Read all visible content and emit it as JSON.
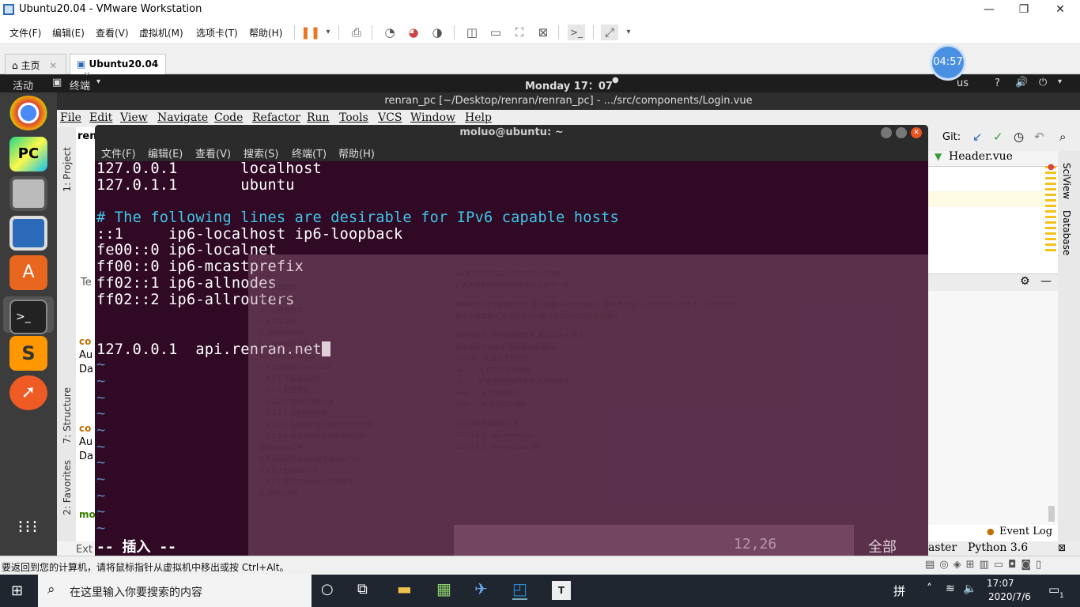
{
  "vmware": {
    "title": "Ubuntu20.04 - VMware Workstation",
    "menu": [
      "文件(F)",
      "编辑(E)",
      "查看(V)",
      "虚拟机(M)",
      "选项卡(T)",
      "帮助(H)"
    ],
    "tabs": [
      {
        "label": "主页"
      },
      {
        "label": "Ubuntu20.04"
      }
    ],
    "timer": "04:57",
    "status_text": "要返回到您的计算机，请将鼠标指针从虚拟机中移出或按 Ctrl+Alt。"
  },
  "ubuntu": {
    "activities": "活动",
    "app_menu": "终端",
    "clock": "Monday 17：07",
    "status_fragment": "us"
  },
  "ide": {
    "title": "renran_pc [~/Desktop/renran/renran_pc] - .../src/components/Login.vue",
    "menu": [
      "File",
      "Edit",
      "View",
      "Navigate",
      "Code",
      "Refactor",
      "Run",
      "Tools",
      "VCS",
      "Window",
      "Help"
    ],
    "git_label": "Git:",
    "file_tab": "Header.vue",
    "side_labels": [
      "1: Project",
      "7: Structure",
      "2: Favorites"
    ],
    "right_labels": [
      "SciView",
      "Database"
    ],
    "event_log": "Event Log",
    "branch": "aster",
    "interpreter": "Python 3.6",
    "fragments": [
      "ren",
      "Te",
      "co",
      "Au",
      "Da",
      "co",
      "Au",
      "Da",
      "mo",
      "Ext"
    ]
  },
  "terminal": {
    "title": "moluo@ubuntu: ~",
    "menu": [
      "文件(F)",
      "编辑(E)",
      "查看(V)",
      "搜索(S)",
      "终端(T)",
      "帮助(H)"
    ],
    "lines": [
      {
        "text": "127.0.0.1       localhost",
        "kind": "normal"
      },
      {
        "text": "127.0.1.1       ubuntu",
        "kind": "normal"
      },
      {
        "text": "",
        "kind": "normal"
      },
      {
        "text": "# The following lines are desirable for IPv6 capable hosts",
        "kind": "comment"
      },
      {
        "text": "::1     ip6-localhost ip6-loopback",
        "kind": "normal"
      },
      {
        "text": "fe00::0 ip6-localnet",
        "kind": "normal"
      },
      {
        "text": "ff00::0 ip6-mcastprefix",
        "kind": "normal"
      },
      {
        "text": "ff02::1 ip6-allnodes",
        "kind": "normal"
      },
      {
        "text": "ff02::2 ip6-allrouters",
        "kind": "normal"
      },
      {
        "text": "",
        "kind": "normal"
      },
      {
        "text": "",
        "kind": "normal"
      },
      {
        "text": "127.0.0.1  api.renran.net",
        "kind": "cursor"
      },
      {
        "text": "~",
        "kind": "tilde"
      },
      {
        "text": "~",
        "kind": "tilde"
      },
      {
        "text": "~",
        "kind": "tilde"
      },
      {
        "text": "~",
        "kind": "tilde"
      },
      {
        "text": "~",
        "kind": "tilde"
      },
      {
        "text": "~",
        "kind": "tilde"
      },
      {
        "text": "~",
        "kind": "tilde"
      },
      {
        "text": "~",
        "kind": "tilde"
      },
      {
        "text": "~",
        "kind": "tilde"
      },
      {
        "text": "~",
        "kind": "tilde"
      },
      {
        "text": "~",
        "kind": "tilde"
      }
    ],
    "mode": "-- 插入 --",
    "position": "12,26",
    "scroll": "全部"
  },
  "ghost_doc": {
    "toc": [
      "大纲",
      "4.5 日志配置",
      "4.6 异常处理",
      "4.7 创建数据库",
      "4.8 常见错误",
      "5. 搭建前端项目",
      "5.1 创建项目目录",
      "5.2 初始化前端项目",
      "5.3 安装路由vue-router",
      "5.3.1 下载路由组件",
      "5.3.2 配置路由",
      "5.3.2.1 初始化路由对象",
      "5.3.2.2 注册路由信息",
      "5.3.2.3 在视图中显示路由对应的内容",
      "5.3.2.4 创建并提供前端首页的组件",
      "创建Home组件",
      "5.4 前端初始化全局变量和全局方法",
      "5.5 引入ElementUI",
      "5.5.1 配置ElementUI到项目中",
      "6. 跨域CORS"
    ],
    "body": [
      "dd 表示剪切当前光标所在的一行内容",
      "p 表示把复制的内容粘贴到光标的下一行",
      "编辑模式: 在快捷键模式中,通过按键i/a/A/I/O/o进入,其中i表示插入,a表示追加,o表示下一行新增内容",
      "要退出编辑模式,使用按键Esc[复位键]即可返回快捷键模式",
      "命令行模式: 在快捷键模式中,通过shift+:进入",
      "要退出命令行模式,也是使用按键Esc.",
      ":set nu   # 显示文件行号",
      ":w        # 保存文件的修改",
      ":q        # 退出当前操作文件,关闭编辑器",
      ":wq       # 保存并退出",
      ":wq!      # 强制保存退出",
      "在文件中增加两条信息",
      "127.0.0.1   api.renran.cn",
      "127.0.0.1   www.moluo.net"
    ]
  },
  "taskbar": {
    "search_placeholder": "在这里输入你要搜索的内容",
    "ime": "拼",
    "time": "17:07",
    "date": "2020/7/6",
    "notification_count": "1"
  }
}
